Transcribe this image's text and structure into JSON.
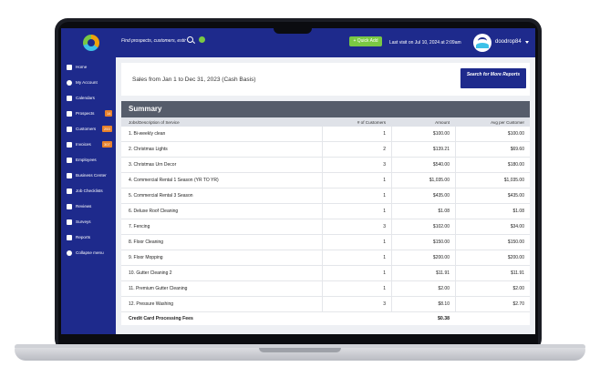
{
  "topbar": {
    "search_placeholder": "Find prospects, customers, estir",
    "quick_add_label": "+ Quick Add",
    "last_visit": "Last visit on  Jul 10, 2024  at 2:09am",
    "username": "doodrop84"
  },
  "sidebar": {
    "items": [
      {
        "label": "Home",
        "badge": ""
      },
      {
        "label": "My Account",
        "badge": ""
      },
      {
        "label": "Calendars",
        "badge": ""
      },
      {
        "label": "Prospects",
        "badge": "14"
      },
      {
        "label": "Customers",
        "badge": "253"
      },
      {
        "label": "Invoices",
        "badge": "307"
      },
      {
        "label": "Employees",
        "badge": ""
      },
      {
        "label": "Business Center",
        "badge": ""
      },
      {
        "label": "Job Checklists",
        "badge": ""
      },
      {
        "label": "Reviews",
        "badge": ""
      },
      {
        "label": "Surveys",
        "badge": ""
      },
      {
        "label": "Reports",
        "badge": ""
      },
      {
        "label": "Collapse menu",
        "badge": ""
      }
    ]
  },
  "header": {
    "title": "Sales from Jan 1 to Dec 31, 2023 (Cash Basis)",
    "search_more_label": "Search for More Reports"
  },
  "summary": {
    "title": "Summary",
    "columns": [
      "Jobs/Description of Service",
      "# of Customers",
      "Amount",
      "Avg per Customer"
    ],
    "rows": [
      [
        "1. Bi-weekly clean",
        "1",
        "$100.00",
        "$100.00"
      ],
      [
        "2. Christmas Lights",
        "2",
        "$139.21",
        "$69.60"
      ],
      [
        "3. Christmas Urn Decor",
        "3",
        "$540.00",
        "$180.00"
      ],
      [
        "4. Commercial Rental 1 Season (YR TO YR)",
        "1",
        "$1,035.00",
        "$1,035.00"
      ],
      [
        "5. Commercial Rental 3 Season",
        "1",
        "$435.00",
        "$435.00"
      ],
      [
        "6. Deluxe Roof Cleaning",
        "1",
        "$1.08",
        "$1.08"
      ],
      [
        "7. Fencing",
        "3",
        "$102.00",
        "$34.00"
      ],
      [
        "8. Floor Cleaning",
        "1",
        "$150.00",
        "$150.00"
      ],
      [
        "9. Floor Mopping",
        "1",
        "$200.00",
        "$200.00"
      ],
      [
        "10. Gutter Cleaning 2",
        "1",
        "$11.91",
        "$11.91"
      ],
      [
        "11. Premium Gutter Cleaning",
        "1",
        "$2.00",
        "$2.00"
      ],
      [
        "12. Pressure Washing",
        "3",
        "$8.10",
        "$2.70"
      ]
    ],
    "footer_label": "Credit Card Processing Fees",
    "footer_amount": "$0.38"
  },
  "colors": {
    "brand_blue": "#1e2a8c",
    "quick_add_green": "#7ac943",
    "badge_orange": "#e8812b",
    "summary_header": "#565d6b",
    "fab_orange": "#f29a3c"
  }
}
